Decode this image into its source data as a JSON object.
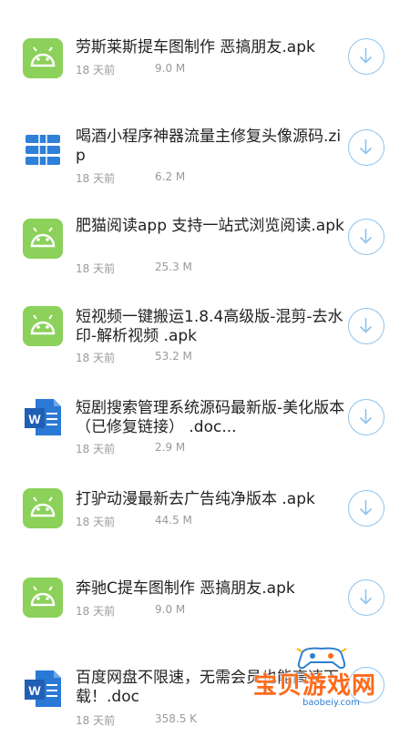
{
  "files": [
    {
      "icon": "apk-file-icon",
      "title": "劳斯莱斯提车图制作 恶搞朋友.apk",
      "time": "18 天前",
      "size": "9.0 M"
    },
    {
      "icon": "zip-file-icon",
      "title": "喝酒小程序神器流量主修复头像源码.zip",
      "time": "18 天前",
      "size": "6.2 M"
    },
    {
      "icon": "apk-file-icon",
      "title": "肥猫阅读app 支持一站式浏览阅读.apk",
      "time": "18 天前",
      "size": "25.3 M"
    },
    {
      "icon": "apk-file-icon",
      "title": "短视频一键搬运1.8.4高级版-混剪-去水印-解析视频 .apk",
      "time": "18 天前",
      "size": "53.2 M"
    },
    {
      "icon": "word-file-icon",
      "title": "短剧搜索管理系统源码最新版-美化版本（已修复链接） .doc...",
      "time": "18 天前",
      "size": "2.9 M"
    },
    {
      "icon": "apk-file-icon",
      "title": "打驴动漫最新去广告纯净版本 .apk",
      "time": "18 天前",
      "size": "44.5 M"
    },
    {
      "icon": "apk-file-icon",
      "title": "奔驰C提车图制作 恶搞朋友.apk",
      "time": "18 天前",
      "size": "9.0 M"
    },
    {
      "icon": "word-file-icon",
      "title": "百度网盘不限速，无需会员也能高速下载！.doc",
      "time": "18 天前",
      "size": "358.5 K"
    }
  ],
  "download_icon": "download-icon",
  "watermark": {
    "text": "宝贝游戏网",
    "url": "baobeiy.com"
  },
  "colors": {
    "apk": "#8bd15a",
    "zip": "#2f80d8",
    "word": "#2b79d6",
    "download_ring": "#8ec3ec",
    "meta": "#9a9a9a"
  }
}
